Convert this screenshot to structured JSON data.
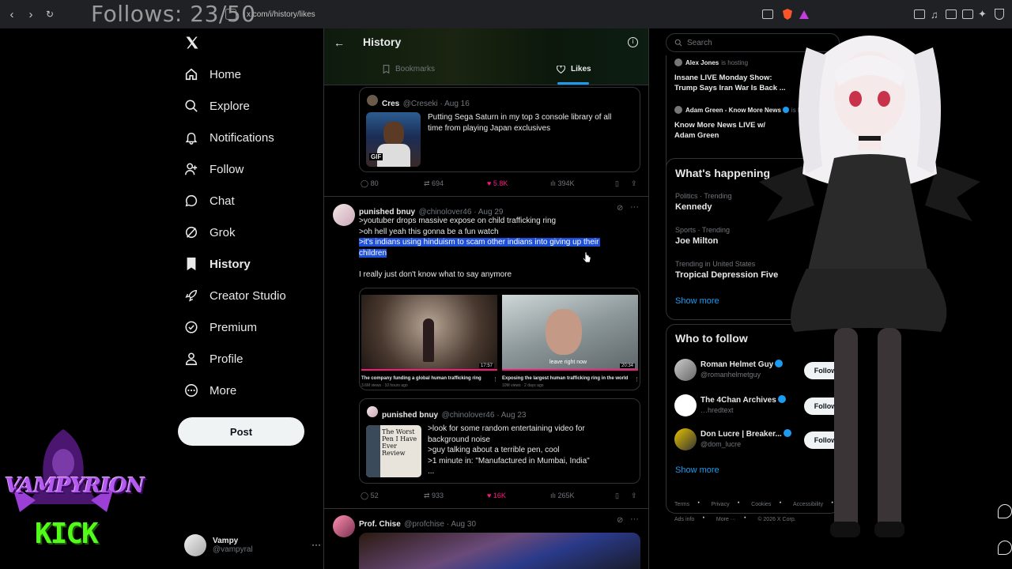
{
  "overlay": {
    "follows_text": "Follows: 23/50"
  },
  "browser": {
    "url": "x.com/i/history/likes"
  },
  "sidebar": {
    "items": [
      {
        "label": "Home"
      },
      {
        "label": "Explore"
      },
      {
        "label": "Notifications"
      },
      {
        "label": "Follow"
      },
      {
        "label": "Chat"
      },
      {
        "label": "Grok"
      },
      {
        "label": "History"
      },
      {
        "label": "Creator Studio"
      },
      {
        "label": "Premium"
      },
      {
        "label": "Profile"
      },
      {
        "label": "More"
      }
    ],
    "post_label": "Post",
    "profile": {
      "name": "Vampy",
      "handle": "@vampyral",
      "more": "···"
    }
  },
  "header": {
    "title": "History",
    "tabs": [
      {
        "label": "Bookmarks"
      },
      {
        "label": "Likes"
      }
    ]
  },
  "tweets": {
    "t0": {
      "quote": {
        "name": "Cres",
        "handle": "@Creseki · Aug 16",
        "text1": "Putting Sega Saturn in my top 3 console library of all",
        "text2": "time from playing Japan exclusives",
        "gif": "GIF"
      },
      "replies": "80",
      "reposts": "694",
      "likes": "5.8K",
      "views": "394K"
    },
    "t1": {
      "name": "punished bnuy",
      "meta": "@chinolover46 · Aug 29",
      "lines": [
        ">youtuber drops massive expose on child trafficking ring",
        ">oh hell yeah this gonna be a fun watch",
        ">it's indians using hinduism to scam other indians into giving up their",
        "children"
      ],
      "after": "I really just don't know what to say anymore",
      "videos": [
        {
          "title": "The company funding a global human trafficking ring",
          "meta": "3.6M views · 10 hours ago",
          "time": "17:57"
        },
        {
          "title": "Exposing the largest human trafficking ring in the world",
          "meta": "10M views · 2 days ago",
          "time": "20:34",
          "caption": "leave right now"
        }
      ],
      "quote": {
        "name": "punished bnuy",
        "meta": "@chinolover46 · Aug 23",
        "lines": [
          ">look for some random entertaining video for",
          "background noise",
          ">guy talking about a terrible pen, cool",
          ">1 minute in: \"Manufactured in Mumbai, India\"",
          "..."
        ],
        "thumb_text": "The Worst Pen I Have Ever Review"
      },
      "replies": "52",
      "reposts": "933",
      "likes": "16K",
      "views": "265K"
    },
    "t2": {
      "name": "Prof. Chise",
      "meta": "@profchise · Aug 30"
    }
  },
  "right": {
    "search_placeholder": "Search",
    "live": [
      {
        "host": "Alex Jones",
        "hosting": "is hosting",
        "title1": "Insane LIVE Monday Show:",
        "title2": "Trump Says Iran War Is Back ..."
      },
      {
        "host": "Adam Green - Know More News",
        "hosting": "is h",
        "title1": "Know More News LIVE w/",
        "title2": "Adam Green"
      }
    ],
    "happening": {
      "title": "What's happening",
      "items": [
        {
          "ctx": "Politics · Trending",
          "name": "Kennedy"
        },
        {
          "ctx": "Sports · Trending",
          "name": "Joe Milton"
        },
        {
          "ctx": "Trending in United States",
          "name": "Tropical Depression Five"
        }
      ],
      "show_more": "Show more"
    },
    "who": {
      "title": "Who to follow",
      "items": [
        {
          "name": "Roman Helmet Guy",
          "handle": "@romanhelmetguy",
          "btn": "Follow"
        },
        {
          "name": "The 4Chan Archives",
          "handle": "…hredtext",
          "btn": "Follow"
        },
        {
          "name": "Don Lucre | Breaker...",
          "handle": "@dom_lucre",
          "btn": "Follow"
        }
      ],
      "show_more": "Show more"
    },
    "footer": {
      "l1": "Terms",
      "l2": "Privacy",
      "l3": "Cookies",
      "l4": "Accessibility",
      "l5": "Ads info",
      "l6": "More ···",
      "l7": "© 2026 X Corp."
    }
  },
  "branding": {
    "logo_text": "VAMPYRION",
    "kick_text": "KICK"
  },
  "colors": {
    "like": "#f91880",
    "accent": "#1d9bf0",
    "highlight": "#1d4fd8",
    "kick": "#53fc18",
    "logo_purple": "#9b3fd6"
  }
}
